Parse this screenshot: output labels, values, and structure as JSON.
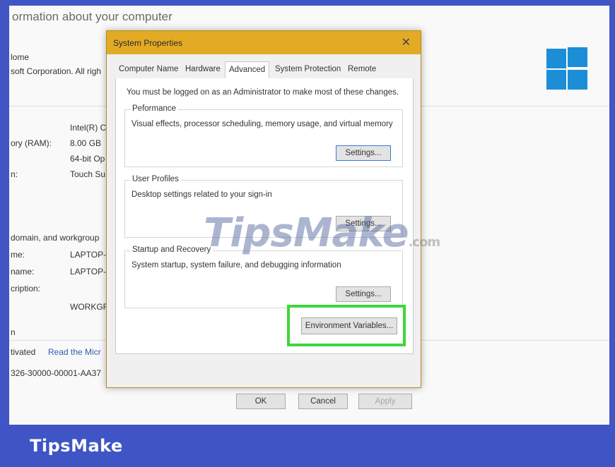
{
  "background_window": {
    "header": "ormation about your computer",
    "edition_line1": "lome",
    "edition_line2": "soft Corporation. All righ",
    "processor_value": "Intel(R) C",
    "ram_label": "ory (RAM):",
    "ram_value": "8.00 GB",
    "system_type_value": "64-bit Op",
    "pen_label": "n:",
    "pen_value": "Touch Su",
    "section_domain": "domain, and workgroup",
    "computer_name_label": "me:",
    "computer_name_value": "LAPTOP-",
    "full_name_label": "name:",
    "full_name_value": "LAPTOP-",
    "description_label": "cription:",
    "workgroup_value": "WORKGR",
    "activation_section": "n",
    "activated_text": "tivated",
    "read_link": "Read the Micr",
    "product_id": "326-30000-00001-AA37"
  },
  "dialog": {
    "title": "System Properties",
    "close_glyph": "✕",
    "tabs": [
      "Computer Name",
      "Hardware",
      "Advanced",
      "System Protection",
      "Remote"
    ],
    "active_tab": "Advanced",
    "note": "You must be logged on as an Administrator to make most of these changes.",
    "performance": {
      "label": "Peformance",
      "description": "Visual effects, processor scheduling, memory usage, and virtual memory",
      "button": "Settings..."
    },
    "user_profiles": {
      "label": "User Profiles",
      "description": "Desktop settings related to your sign-in",
      "button": "Settings..."
    },
    "startup": {
      "label": "Startup and Recovery",
      "description": "System startup, system failure, and debugging information",
      "button": "Settings..."
    },
    "env_button": "Environment Variables...",
    "ok": "OK",
    "cancel": "Cancel",
    "apply": "Apply"
  },
  "watermark": {
    "main": "TipsMake",
    "suffix": ".com"
  },
  "banner": {
    "brand": "TipsMake"
  },
  "colors": {
    "frame": "#4156c4",
    "titlebar": "#e3aa25",
    "highlight": "#3fd63a",
    "windows_logo": "#1c8ed7"
  }
}
